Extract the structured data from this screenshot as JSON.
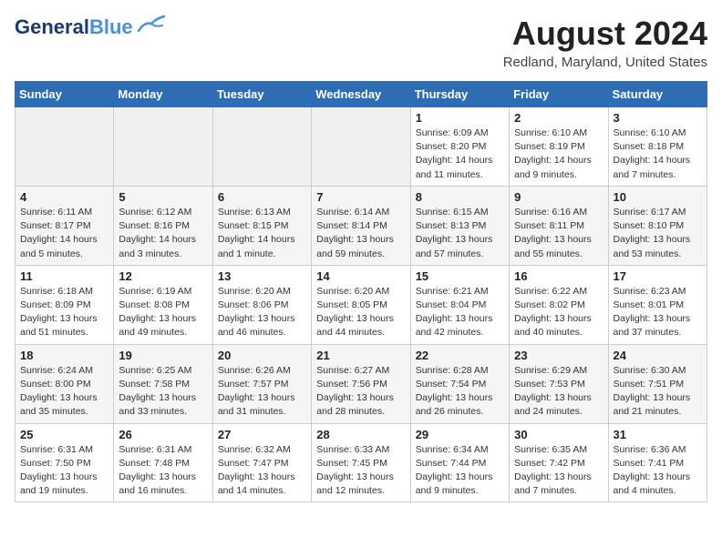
{
  "header": {
    "logo_general": "General",
    "logo_blue": "Blue",
    "main_title": "August 2024",
    "sub_title": "Redland, Maryland, United States"
  },
  "calendar": {
    "days_of_week": [
      "Sunday",
      "Monday",
      "Tuesday",
      "Wednesday",
      "Thursday",
      "Friday",
      "Saturday"
    ],
    "weeks": [
      [
        {
          "day": "",
          "info": ""
        },
        {
          "day": "",
          "info": ""
        },
        {
          "day": "",
          "info": ""
        },
        {
          "day": "",
          "info": ""
        },
        {
          "day": "1",
          "info": "Sunrise: 6:09 AM\nSunset: 8:20 PM\nDaylight: 14 hours\nand 11 minutes."
        },
        {
          "day": "2",
          "info": "Sunrise: 6:10 AM\nSunset: 8:19 PM\nDaylight: 14 hours\nand 9 minutes."
        },
        {
          "day": "3",
          "info": "Sunrise: 6:10 AM\nSunset: 8:18 PM\nDaylight: 14 hours\nand 7 minutes."
        }
      ],
      [
        {
          "day": "4",
          "info": "Sunrise: 6:11 AM\nSunset: 8:17 PM\nDaylight: 14 hours\nand 5 minutes."
        },
        {
          "day": "5",
          "info": "Sunrise: 6:12 AM\nSunset: 8:16 PM\nDaylight: 14 hours\nand 3 minutes."
        },
        {
          "day": "6",
          "info": "Sunrise: 6:13 AM\nSunset: 8:15 PM\nDaylight: 14 hours\nand 1 minute."
        },
        {
          "day": "7",
          "info": "Sunrise: 6:14 AM\nSunset: 8:14 PM\nDaylight: 13 hours\nand 59 minutes."
        },
        {
          "day": "8",
          "info": "Sunrise: 6:15 AM\nSunset: 8:13 PM\nDaylight: 13 hours\nand 57 minutes."
        },
        {
          "day": "9",
          "info": "Sunrise: 6:16 AM\nSunset: 8:11 PM\nDaylight: 13 hours\nand 55 minutes."
        },
        {
          "day": "10",
          "info": "Sunrise: 6:17 AM\nSunset: 8:10 PM\nDaylight: 13 hours\nand 53 minutes."
        }
      ],
      [
        {
          "day": "11",
          "info": "Sunrise: 6:18 AM\nSunset: 8:09 PM\nDaylight: 13 hours\nand 51 minutes."
        },
        {
          "day": "12",
          "info": "Sunrise: 6:19 AM\nSunset: 8:08 PM\nDaylight: 13 hours\nand 49 minutes."
        },
        {
          "day": "13",
          "info": "Sunrise: 6:20 AM\nSunset: 8:06 PM\nDaylight: 13 hours\nand 46 minutes."
        },
        {
          "day": "14",
          "info": "Sunrise: 6:20 AM\nSunset: 8:05 PM\nDaylight: 13 hours\nand 44 minutes."
        },
        {
          "day": "15",
          "info": "Sunrise: 6:21 AM\nSunset: 8:04 PM\nDaylight: 13 hours\nand 42 minutes."
        },
        {
          "day": "16",
          "info": "Sunrise: 6:22 AM\nSunset: 8:02 PM\nDaylight: 13 hours\nand 40 minutes."
        },
        {
          "day": "17",
          "info": "Sunrise: 6:23 AM\nSunset: 8:01 PM\nDaylight: 13 hours\nand 37 minutes."
        }
      ],
      [
        {
          "day": "18",
          "info": "Sunrise: 6:24 AM\nSunset: 8:00 PM\nDaylight: 13 hours\nand 35 minutes."
        },
        {
          "day": "19",
          "info": "Sunrise: 6:25 AM\nSunset: 7:58 PM\nDaylight: 13 hours\nand 33 minutes."
        },
        {
          "day": "20",
          "info": "Sunrise: 6:26 AM\nSunset: 7:57 PM\nDaylight: 13 hours\nand 31 minutes."
        },
        {
          "day": "21",
          "info": "Sunrise: 6:27 AM\nSunset: 7:56 PM\nDaylight: 13 hours\nand 28 minutes."
        },
        {
          "day": "22",
          "info": "Sunrise: 6:28 AM\nSunset: 7:54 PM\nDaylight: 13 hours\nand 26 minutes."
        },
        {
          "day": "23",
          "info": "Sunrise: 6:29 AM\nSunset: 7:53 PM\nDaylight: 13 hours\nand 24 minutes."
        },
        {
          "day": "24",
          "info": "Sunrise: 6:30 AM\nSunset: 7:51 PM\nDaylight: 13 hours\nand 21 minutes."
        }
      ],
      [
        {
          "day": "25",
          "info": "Sunrise: 6:31 AM\nSunset: 7:50 PM\nDaylight: 13 hours\nand 19 minutes."
        },
        {
          "day": "26",
          "info": "Sunrise: 6:31 AM\nSunset: 7:48 PM\nDaylight: 13 hours\nand 16 minutes."
        },
        {
          "day": "27",
          "info": "Sunrise: 6:32 AM\nSunset: 7:47 PM\nDaylight: 13 hours\nand 14 minutes."
        },
        {
          "day": "28",
          "info": "Sunrise: 6:33 AM\nSunset: 7:45 PM\nDaylight: 13 hours\nand 12 minutes."
        },
        {
          "day": "29",
          "info": "Sunrise: 6:34 AM\nSunset: 7:44 PM\nDaylight: 13 hours\nand 9 minutes."
        },
        {
          "day": "30",
          "info": "Sunrise: 6:35 AM\nSunset: 7:42 PM\nDaylight: 13 hours\nand 7 minutes."
        },
        {
          "day": "31",
          "info": "Sunrise: 6:36 AM\nSunset: 7:41 PM\nDaylight: 13 hours\nand 4 minutes."
        }
      ]
    ]
  }
}
